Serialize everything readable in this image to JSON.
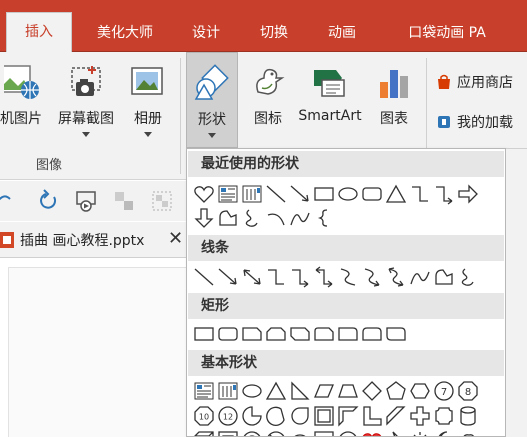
{
  "tabs": [
    {
      "label": "插入",
      "active": true
    },
    {
      "label": "美化大师",
      "active": false
    },
    {
      "label": "设计",
      "active": false
    },
    {
      "label": "切换",
      "active": false
    },
    {
      "label": "动画",
      "active": false
    },
    {
      "label": "口袋动画 PA",
      "active": false
    }
  ],
  "ribbon": {
    "images_group": {
      "label": "图像",
      "buttons": [
        {
          "label": "机图片",
          "icon": "online-picture-icon"
        },
        {
          "label": "屏幕截图",
          "icon": "screenshot-icon"
        },
        {
          "label": "相册",
          "icon": "photo-album-icon"
        }
      ]
    },
    "illustrations": [
      {
        "label": "形状",
        "icon": "shapes-icon",
        "pressed": true
      },
      {
        "label": "图标",
        "icon": "icons-icon"
      },
      {
        "label": "SmartArt",
        "icon": "smartart-icon"
      },
      {
        "label": "图表",
        "icon": "chart-icon"
      }
    ],
    "addins": [
      {
        "label": "应用商店",
        "icon": "store-icon"
      },
      {
        "label": "我的加载",
        "icon": "my-addins-icon"
      }
    ]
  },
  "document": {
    "file_name": "插曲 画心教程.pptx",
    "close_glyph": "✕"
  },
  "shapes_menu": {
    "sections": [
      {
        "title": "最近使用的形状"
      },
      {
        "title": "线条"
      },
      {
        "title": "矩形"
      },
      {
        "title": "基本形状"
      }
    ]
  },
  "colors": {
    "brand": "#c8402b",
    "ribbon_bg": "#f2f2f2",
    "section_header_bg": "#e6e6e6",
    "heart_red": "#e03a3a"
  }
}
